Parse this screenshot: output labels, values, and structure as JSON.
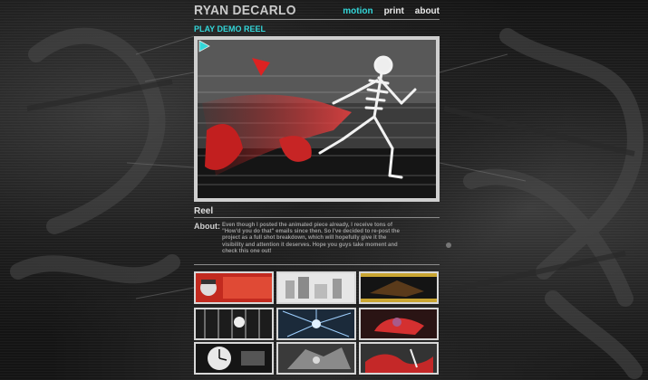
{
  "site": {
    "logo": "RYAN DECARLO"
  },
  "nav": {
    "items": [
      {
        "label": "motion",
        "active": true
      },
      {
        "label": "print",
        "active": false
      },
      {
        "label": "about",
        "active": false
      }
    ]
  },
  "player": {
    "play_link": "PLAY DEMO REEL",
    "play_icon": "play-icon"
  },
  "reel": {
    "title": "Reel",
    "about_label": "About:",
    "about_text": "Even though I posted the animated piece already, I receive tons of \"How'd you do that\" emails since then. So I've decided to re-post the project as a full shot breakdown, which will hopefully give it the visibility and attention it deserves. Hope you guys take moment and check this one out!"
  },
  "thumbnails": [
    {
      "name": "thumb-1",
      "theme": "red-brush-face"
    },
    {
      "name": "thumb-2",
      "theme": "white-cityscape"
    },
    {
      "name": "thumb-3",
      "theme": "dark-gold-frame"
    },
    {
      "name": "thumb-4",
      "theme": "dark-skeleton-cage"
    },
    {
      "name": "thumb-5",
      "theme": "blue-burst"
    },
    {
      "name": "thumb-6",
      "theme": "red-hand"
    },
    {
      "name": "thumb-7",
      "theme": "clock-face"
    },
    {
      "name": "thumb-8",
      "theme": "mech-gray"
    },
    {
      "name": "thumb-9",
      "theme": "red-splash"
    }
  ],
  "colors": {
    "accent": "#33d6d9",
    "text": "#e9e9e9",
    "frame": "#cfcfcf"
  }
}
